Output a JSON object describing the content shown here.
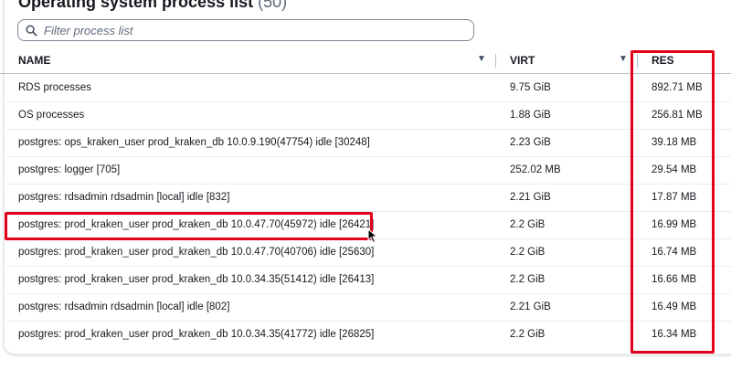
{
  "header": {
    "title": "Operating system process list",
    "count": "(50)"
  },
  "search": {
    "placeholder": "Filter process list",
    "icon": "search-icon"
  },
  "columns": {
    "name": "NAME",
    "virt": "VIRT",
    "res": "RES"
  },
  "rows": [
    {
      "name": "RDS processes",
      "virt": "9.75 GiB",
      "res": "892.71 MB"
    },
    {
      "name": "OS processes",
      "virt": "1.88 GiB",
      "res": "256.81 MB"
    },
    {
      "name": "postgres: ops_kraken_user prod_kraken_db 10.0.9.190(47754) idle [30248]",
      "virt": "2.23 GiB",
      "res": "39.18 MB"
    },
    {
      "name": "postgres: logger [705]",
      "virt": "252.02 MB",
      "res": "29.54 MB"
    },
    {
      "name": "postgres: rdsadmin rdsadmin [local] idle [832]",
      "virt": "2.21 GiB",
      "res": "17.87 MB"
    },
    {
      "name": "postgres: prod_kraken_user prod_kraken_db 10.0.47.70(45972) idle [26421]",
      "virt": "2.2 GiB",
      "res": "16.99 MB"
    },
    {
      "name": "postgres: prod_kraken_user prod_kraken_db 10.0.47.70(40706) idle [25630]",
      "virt": "2.2 GiB",
      "res": "16.74 MB"
    },
    {
      "name": "postgres: prod_kraken_user prod_kraken_db 10.0.34.35(51412) idle [26413]",
      "virt": "2.2 GiB",
      "res": "16.66 MB"
    },
    {
      "name": "postgres: rdsadmin rdsadmin [local] idle [802]",
      "virt": "2.21 GiB",
      "res": "16.49 MB"
    },
    {
      "name": "postgres: prod_kraken_user prod_kraken_db 10.0.34.35(41772) idle [26825]",
      "virt": "2.2 GiB",
      "res": "16.34 MB"
    }
  ],
  "colors": {
    "highlight": "#e2001a",
    "text": "#16191f",
    "divider": "#e9ebed"
  }
}
